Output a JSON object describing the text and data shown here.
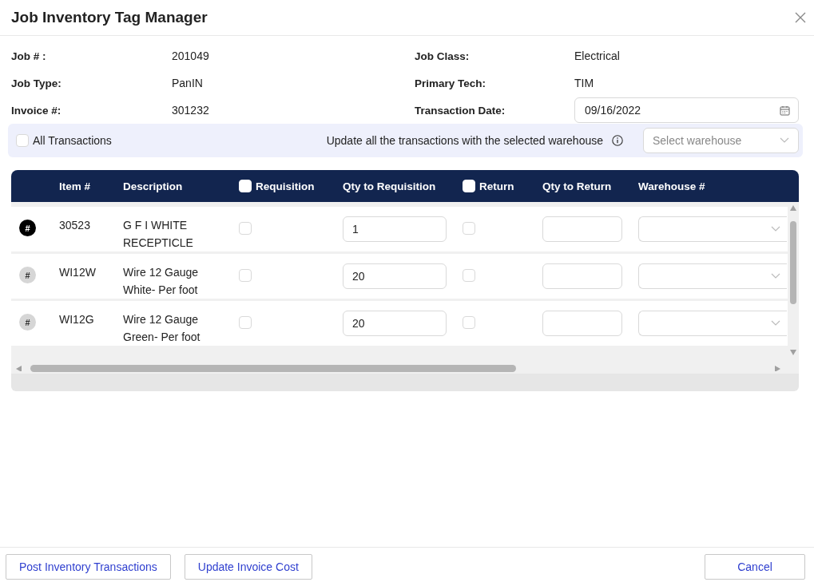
{
  "window": {
    "title": "Job Inventory Tag Manager"
  },
  "info": [
    {
      "label": "Job # :",
      "value": "201049"
    },
    {
      "label": "Job Class:",
      "value": "Electrical"
    },
    {
      "label": "Job Type:",
      "value": "PanIN"
    },
    {
      "label": "Primary Tech:",
      "value": "TIM"
    },
    {
      "label": "Invoice #:",
      "value": "301232"
    },
    {
      "label": "Transaction Date:",
      "value": "09/16/2022",
      "kind": "date"
    }
  ],
  "bulk": {
    "all_transactions": {
      "label": "All Transactions",
      "checked": false
    },
    "hint": "Update all the transactions with the selected warehouse",
    "warehouse": {
      "placeholder": "Select warehouse"
    }
  },
  "table": {
    "columns": [
      {
        "label": "Item #"
      },
      {
        "label": "Description"
      },
      {
        "label": "Requisition",
        "kind": "check",
        "checked": false
      },
      {
        "label": "Qty to Requisition"
      },
      {
        "label": "Return",
        "kind": "check",
        "checked": false
      },
      {
        "label": "Qty to Return"
      },
      {
        "label": "Warehouse #"
      }
    ],
    "rows": [
      {
        "badge": "#",
        "selected": true,
        "item": "30523",
        "description": "G F I WHITE RECEPTICLE",
        "requisition": false,
        "qty_requisition": "1",
        "return": false
      },
      {
        "badge": "#",
        "selected": false,
        "item": "WI12W",
        "description": "Wire 12 Gauge White- Per foot",
        "requisition": false,
        "qty_requisition": "20",
        "return": false
      },
      {
        "badge": "#",
        "selected": false,
        "item": "WI12G",
        "description": "Wire 12 Gauge Green- Per foot",
        "requisition": false,
        "qty_requisition": "20",
        "return": false
      }
    ]
  },
  "footer": {
    "left_buttons": [
      "Post Inventory Transactions",
      "Update Invoice Cost"
    ],
    "right_buttons": [
      "Cancel"
    ]
  }
}
